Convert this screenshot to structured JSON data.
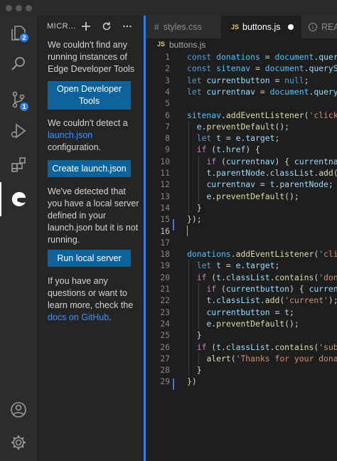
{
  "sidebar": {
    "title": "MICR...",
    "no_instances_text": "We couldn't find any running instances of Edge Developer Tools",
    "open_devtools_button": "Open Developer Tools",
    "no_launch_text_prefix": "We couldn't detect a",
    "launch_link": "launch.json",
    "no_launch_text_suffix": "configuration.",
    "create_launch_button": "Create launch.json",
    "server_text": "We've detected that you have a local server defined in your launch.json but it is not running.",
    "run_server_button": "Run local server",
    "questions_text": "If you have any questions or want to learn more, check the",
    "docs_link": "docs on GitHub",
    "docs_suffix": "."
  },
  "activity": {
    "explorer_badge": "2",
    "scm_badge": "1",
    "icons": [
      "explorer-icon",
      "search-icon",
      "source-control-icon",
      "run-debug-icon",
      "extensions-icon",
      "edge-devtools-icon",
      "account-icon",
      "settings-gear-icon"
    ]
  },
  "tabs": [
    {
      "label": "styles.css",
      "type": "css",
      "active": false
    },
    {
      "label": "buttons.js",
      "type": "js",
      "active": true,
      "modified": true
    },
    {
      "label": "REAI",
      "type": "info",
      "active": false
    }
  ],
  "breadcrumb": {
    "file_label": "buttons.js",
    "type": "JS"
  },
  "colors": {
    "accent": "#2f80ed",
    "button": "#0e639c",
    "link": "#3794ff"
  },
  "code_lines": [
    {
      "n": "1",
      "text": "const donations = document.query"
    },
    {
      "n": "2",
      "text": "const sitenav = document.querySe"
    },
    {
      "n": "3",
      "text": "let currentbutton = null;"
    },
    {
      "n": "4",
      "text": "let currentnav = document.querySe"
    },
    {
      "n": "5",
      "text": ""
    },
    {
      "n": "6",
      "text": "sitenav.addEventListener('click'"
    },
    {
      "n": "7",
      "text": "  e.preventDefault();"
    },
    {
      "n": "8",
      "text": "  let t = e.target;"
    },
    {
      "n": "9",
      "text": "  if (t.href) {"
    },
    {
      "n": "10",
      "text": "    if (currentnav) { currentnav"
    },
    {
      "n": "11",
      "text": "    t.parentNode.classList.add('"
    },
    {
      "n": "12",
      "text": "    currentnav = t.parentNode;"
    },
    {
      "n": "13",
      "text": "    e.preventDefault();"
    },
    {
      "n": "14",
      "text": "  }"
    },
    {
      "n": "15",
      "text": "});"
    },
    {
      "n": "16",
      "text": ""
    },
    {
      "n": "17",
      "text": ""
    },
    {
      "n": "18",
      "text": "donations.addEventListener('clic"
    },
    {
      "n": "19",
      "text": "  let t = e.target;"
    },
    {
      "n": "20",
      "text": "  if (t.classList.contains('dona"
    },
    {
      "n": "21",
      "text": "    if (currentbutton) { current"
    },
    {
      "n": "22",
      "text": "    t.classList.add('current');"
    },
    {
      "n": "23",
      "text": "    currentbutton = t;"
    },
    {
      "n": "24",
      "text": "    e.preventDefault();"
    },
    {
      "n": "25",
      "text": "  }"
    },
    {
      "n": "26",
      "text": "  if (t.classList.contains('subm"
    },
    {
      "n": "27",
      "text": "    alert('Thanks for your donat"
    },
    {
      "n": "28",
      "text": "  }"
    },
    {
      "n": "29",
      "text": "})"
    }
  ],
  "current_line": "16"
}
